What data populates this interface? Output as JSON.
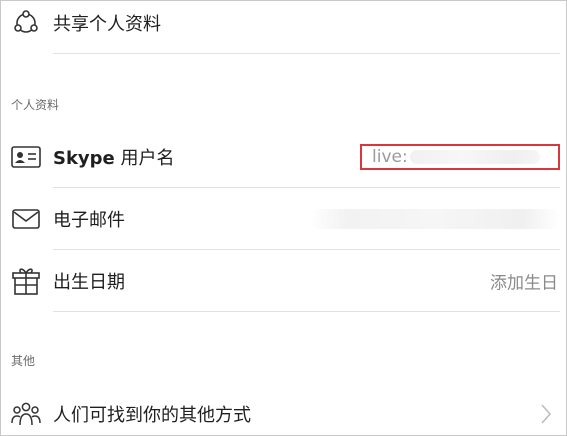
{
  "rows": {
    "share_profile": {
      "label": "共享个人资料",
      "icon": "share-nodes-icon"
    },
    "skype_name": {
      "label_bold": "Skype",
      "label_rest": " 用户名",
      "value": "live:",
      "icon": "id-card-icon"
    },
    "email": {
      "label": "电子邮件",
      "icon": "envelope-icon"
    },
    "birthday": {
      "label": "出生日期",
      "value": "添加生日",
      "icon": "gift-icon"
    },
    "other_ways": {
      "label": "人们可找到你的其他方式",
      "icon": "people-group-icon"
    }
  },
  "sections": {
    "profile": "个人资料",
    "other": "其他"
  },
  "colors": {
    "highlight_border": "#d9363e",
    "divider": "#e2e2e2",
    "muted_text": "#8a8a8a"
  }
}
